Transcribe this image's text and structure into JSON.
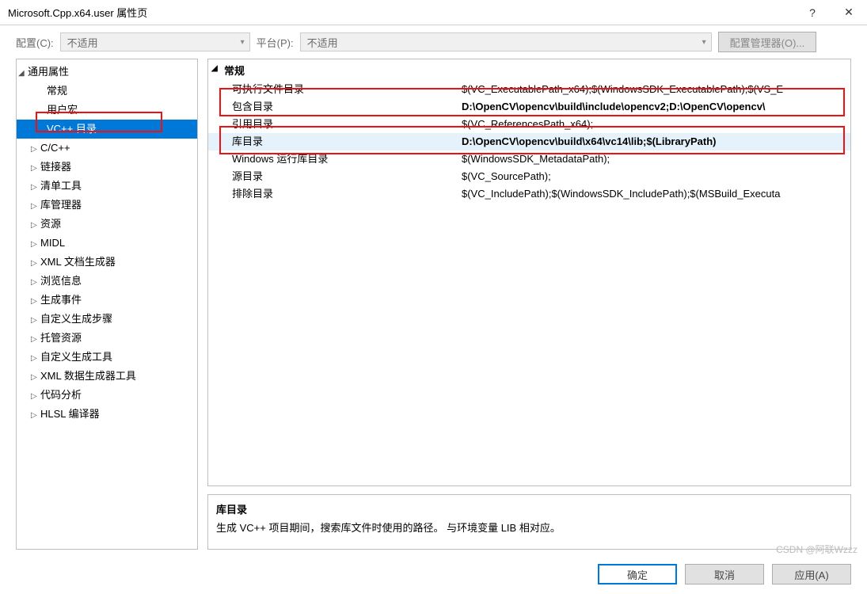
{
  "window": {
    "title": "Microsoft.Cpp.x64.user 属性页",
    "help": "?",
    "close": "✕"
  },
  "toolbar": {
    "config_label": "配置(C):",
    "config_value": "不适用",
    "platform_label": "平台(P):",
    "platform_value": "不适用",
    "manager_btn": "配置管理器(O)..."
  },
  "tree": {
    "root": "通用属性",
    "items": [
      {
        "label": "常规",
        "expandable": false
      },
      {
        "label": "用户宏",
        "expandable": false
      },
      {
        "label": "VC++ 目录",
        "expandable": false,
        "selected": true
      },
      {
        "label": "C/C++",
        "expandable": true
      },
      {
        "label": "链接器",
        "expandable": true
      },
      {
        "label": "清单工具",
        "expandable": true
      },
      {
        "label": "库管理器",
        "expandable": true
      },
      {
        "label": "资源",
        "expandable": true
      },
      {
        "label": "MIDL",
        "expandable": true
      },
      {
        "label": "XML 文档生成器",
        "expandable": true
      },
      {
        "label": "浏览信息",
        "expandable": true
      },
      {
        "label": "生成事件",
        "expandable": true
      },
      {
        "label": "自定义生成步骤",
        "expandable": true
      },
      {
        "label": "托管资源",
        "expandable": true
      },
      {
        "label": "自定义生成工具",
        "expandable": true
      },
      {
        "label": "XML 数据生成器工具",
        "expandable": true
      },
      {
        "label": "代码分析",
        "expandable": true
      },
      {
        "label": "HLSL 编译器",
        "expandable": true
      }
    ]
  },
  "group_header": "常规",
  "props": [
    {
      "label": "可执行文件目录",
      "value": "$(VC_ExecutablePath_x64);$(WindowsSDK_ExecutablePath);$(VS_E"
    },
    {
      "label": "包含目录",
      "value": "D:\\OpenCV\\opencv\\build\\include\\opencv2;D:\\OpenCV\\opencv\\",
      "bold": true
    },
    {
      "label": "引用目录",
      "value": "$(VC_ReferencesPath_x64);"
    },
    {
      "label": "库目录",
      "value": "D:\\OpenCV\\opencv\\build\\x64\\vc14\\lib;$(LibraryPath)",
      "bold": true,
      "selected": true
    },
    {
      "label": "Windows 运行库目录",
      "value": "$(WindowsSDK_MetadataPath);"
    },
    {
      "label": "源目录",
      "value": "$(VC_SourcePath);"
    },
    {
      "label": "排除目录",
      "value": "$(VC_IncludePath);$(WindowsSDK_IncludePath);$(MSBuild_Executa"
    }
  ],
  "desc": {
    "title": "库目录",
    "text": "生成 VC++ 项目期间，搜索库文件时使用的路径。 与环境变量 LIB 相对应。"
  },
  "footer": {
    "ok": "确定",
    "cancel": "取消",
    "apply": "应用(A)"
  },
  "watermark": "CSDN @阿联Wzzz"
}
